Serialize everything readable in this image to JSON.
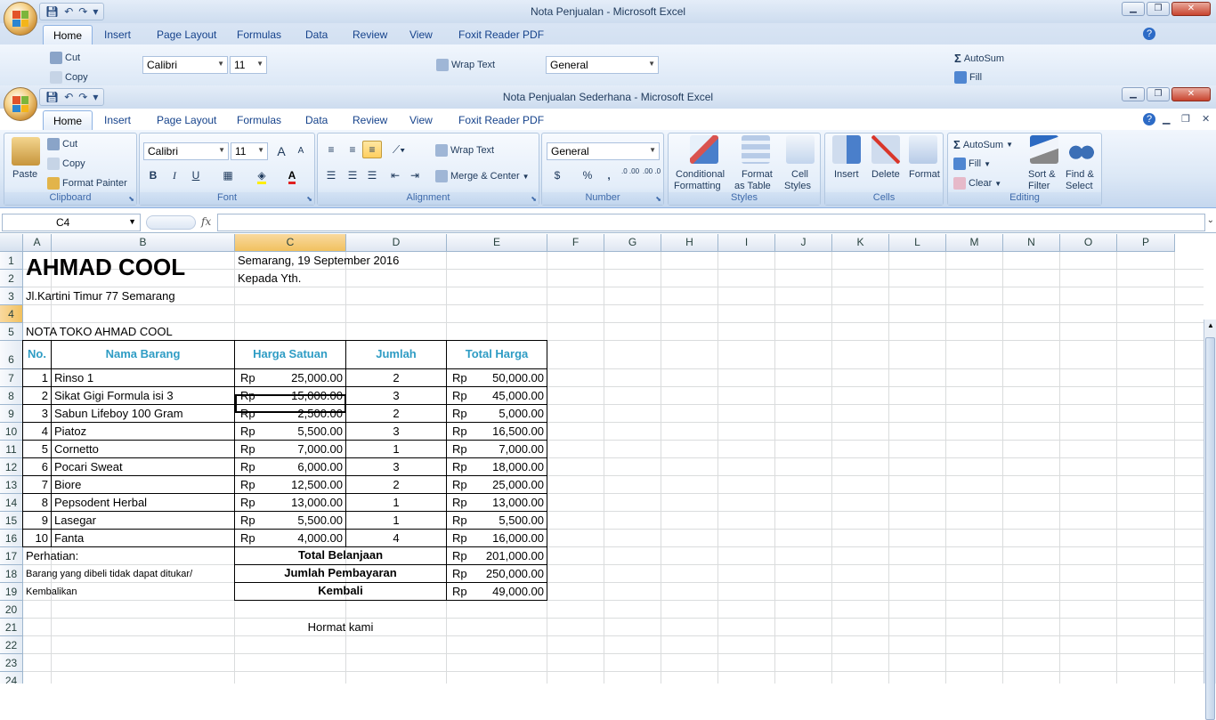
{
  "back_window": {
    "title": "Nota Penjualan - Microsoft Excel",
    "tabs": [
      "Home",
      "Insert",
      "Page Layout",
      "Formulas",
      "Data",
      "Review",
      "View",
      "Foxit Reader PDF"
    ],
    "font_name": "Calibri",
    "font_size": "11",
    "number_format": "General",
    "cut": "Cut",
    "copy": "Copy",
    "wrap": "Wrap Text",
    "autosum": "AutoSum",
    "fill": "Fill"
  },
  "window": {
    "title": "Nota Penjualan Sederhana - Microsoft Excel"
  },
  "tabs": [
    "Home",
    "Insert",
    "Page Layout",
    "Formulas",
    "Data",
    "Review",
    "View",
    "Foxit Reader PDF"
  ],
  "ribbon": {
    "clipboard": {
      "label": "Clipboard",
      "paste": "Paste",
      "cut": "Cut",
      "copy": "Copy",
      "format_painter": "Format Painter"
    },
    "font": {
      "label": "Font",
      "name": "Calibri",
      "size": "11",
      "bold": "B",
      "italic": "I",
      "underline": "U",
      "grow": "A",
      "shrink": "A"
    },
    "alignment": {
      "label": "Alignment",
      "wrap": "Wrap Text",
      "merge": "Merge & Center"
    },
    "number": {
      "label": "Number",
      "format": "General",
      "currency": "$",
      "percent": "%",
      "comma": ",",
      "inc_dec": ".0 .00",
      "dec_dec": ".00 .0"
    },
    "styles": {
      "label": "Styles",
      "conditional": "Conditional",
      "conditional2": "Formatting",
      "format_table": "Format",
      "format_table2": "as Table",
      "cell_styles": "Cell",
      "cell_styles2": "Styles"
    },
    "cells": {
      "label": "Cells",
      "insert": "Insert",
      "delete": "Delete",
      "format": "Format"
    },
    "editing": {
      "label": "Editing",
      "autosum": "AutoSum",
      "fill": "Fill",
      "clear": "Clear",
      "sort": "Sort &",
      "sort2": "Filter",
      "find": "Find &",
      "find2": "Select"
    }
  },
  "formula_bar": {
    "name_box": "C4",
    "fx": "fx",
    "value": ""
  },
  "columns": [
    "A",
    "B",
    "C",
    "D",
    "E",
    "F",
    "G",
    "H",
    "I",
    "J",
    "K",
    "L",
    "M",
    "N",
    "O",
    "P"
  ],
  "rows": [
    "1",
    "2",
    "3",
    "4",
    "5",
    "6",
    "7",
    "8",
    "9",
    "10",
    "11",
    "12",
    "13",
    "14",
    "15",
    "16",
    "17",
    "18",
    "19",
    "20",
    "21",
    "22",
    "23",
    "24"
  ],
  "sheet": {
    "store_name": "AHMAD COOL",
    "date": "Semarang, 19 September 2016",
    "to": "Kepada Yth.",
    "address": "Jl.Kartini Timur 77 Semarang",
    "nota_title": "NOTA TOKO AHMAD COOL",
    "headers": {
      "no": "No.",
      "name": "Nama Barang",
      "price": "Harga Satuan",
      "qty": "Jumlah",
      "total": "Total Harga"
    },
    "currency": "Rp",
    "items": [
      {
        "no": "1",
        "name": "Rinso 1",
        "price": "25,000.00",
        "qty": "2",
        "total": "50,000.00"
      },
      {
        "no": "2",
        "name": "Sikat Gigi Formula isi 3",
        "price": "15,000.00",
        "qty": "3",
        "total": "45,000.00"
      },
      {
        "no": "3",
        "name": "Sabun Lifeboy 100 Gram",
        "price": "2,500.00",
        "qty": "2",
        "total": "5,000.00"
      },
      {
        "no": "4",
        "name": "Piatoz",
        "price": "5,500.00",
        "qty": "3",
        "total": "16,500.00"
      },
      {
        "no": "5",
        "name": "Cornetto",
        "price": "7,000.00",
        "qty": "1",
        "total": "7,000.00"
      },
      {
        "no": "6",
        "name": "Pocari Sweat",
        "price": "6,000.00",
        "qty": "3",
        "total": "18,000.00"
      },
      {
        "no": "7",
        "name": "Biore",
        "price": "12,500.00",
        "qty": "2",
        "total": "25,000.00"
      },
      {
        "no": "8",
        "name": "Pepsodent Herbal",
        "price": "13,000.00",
        "qty": "1",
        "total": "13,000.00"
      },
      {
        "no": "9",
        "name": "Lasegar",
        "price": "5,500.00",
        "qty": "1",
        "total": "5,500.00"
      },
      {
        "no": "10",
        "name": "Fanta",
        "price": "4,000.00",
        "qty": "4",
        "total": "16,000.00"
      }
    ],
    "note_label": "Perhatian:",
    "note_line1": "Barang yang dibeli tidak dapat ditukar/",
    "note_line2": "Kembalikan",
    "summary": [
      {
        "label": "Total Belanjaan",
        "value": "201,000.00"
      },
      {
        "label": "Jumlah Pembayaran",
        "value": "250,000.00"
      },
      {
        "label": "Kembali",
        "value": "49,000.00"
      }
    ],
    "closing": "Hormat kami"
  }
}
